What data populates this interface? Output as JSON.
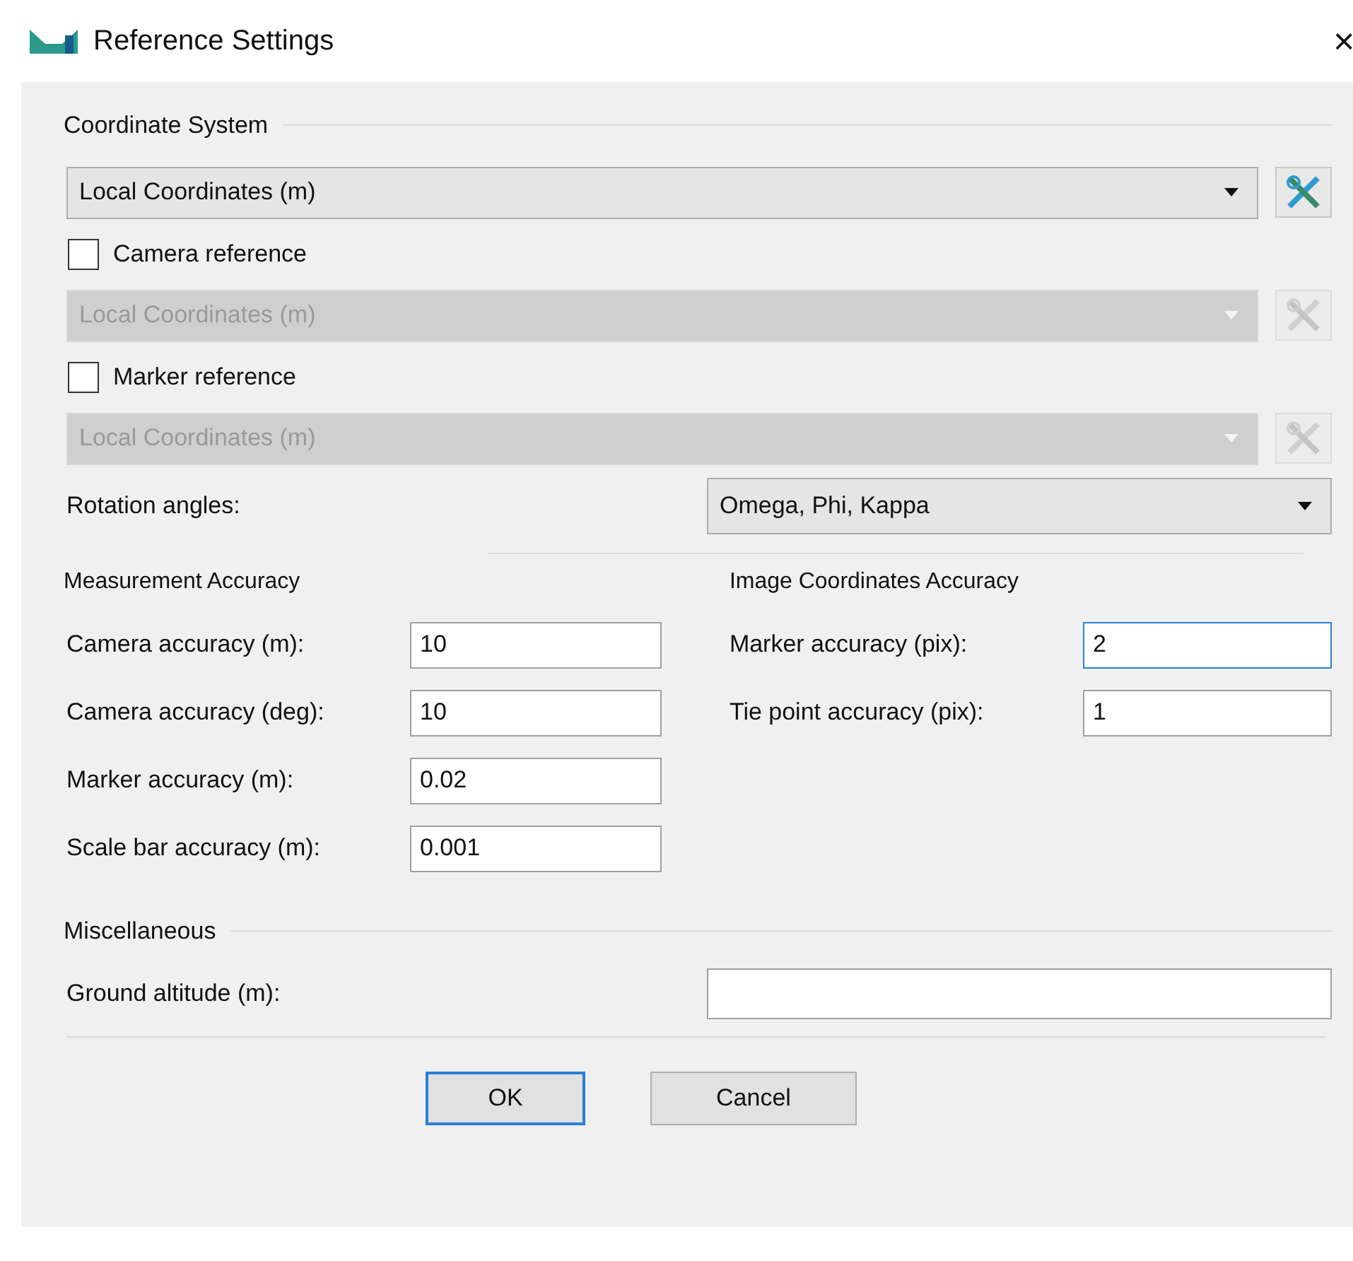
{
  "window": {
    "title": "Reference Settings",
    "close": "×"
  },
  "coordinate_system": {
    "title": "Coordinate System",
    "value": "Local Coordinates (m)",
    "disabled": false
  },
  "references": [
    {
      "label": "Camera reference",
      "checked": false,
      "value": "Local Coordinates (m)",
      "disabled": true
    },
    {
      "label": "Marker reference",
      "checked": false,
      "value": "Local Coordinates (m)",
      "disabled": true
    }
  ],
  "rotation": {
    "label": "Rotation angles:",
    "value": "Omega, Phi, Kappa"
  },
  "measurement": {
    "title": "Measurement Accuracy",
    "fields": [
      {
        "label": "Camera accuracy (m):",
        "value": "10",
        "focused": false
      },
      {
        "label": "Camera accuracy (deg):",
        "value": "10",
        "focused": false
      },
      {
        "label": "Marker accuracy (m):",
        "value": "0.02",
        "focused": false
      },
      {
        "label": "Scale bar accuracy (m):",
        "value": "0.001",
        "focused": false
      }
    ]
  },
  "image_accuracy": {
    "title": "Image Coordinates Accuracy",
    "fields": [
      {
        "label": "Marker accuracy (pix):",
        "value": "2",
        "focused": true
      },
      {
        "label": "Tie point accuracy (pix):",
        "value": "1",
        "focused": false
      }
    ]
  },
  "miscellaneous": {
    "title": "Miscellaneous",
    "fields": [
      {
        "label": "Ground altitude (m):",
        "focused": false
      }
    ]
  },
  "buttons": [
    {
      "label": "OK",
      "default": true
    },
    {
      "label": "Cancel",
      "default": false
    }
  ]
}
